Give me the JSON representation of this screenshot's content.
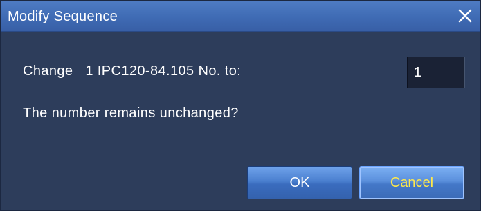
{
  "dialog": {
    "title": "Modify Sequence",
    "close_icon": "close-icon",
    "message_line1": "Change   1 IPC120-84.105 No. to:",
    "message_line2": "The number remains unchanged?",
    "number_field_value": "1",
    "ok_label": "OK",
    "cancel_label": "Cancel"
  },
  "colors": {
    "titlebar": "#3f6bb4",
    "dialog_background": "#2d3d5b",
    "button_blue": "#4a7fcf",
    "cancel_text": "#ffe94a"
  }
}
